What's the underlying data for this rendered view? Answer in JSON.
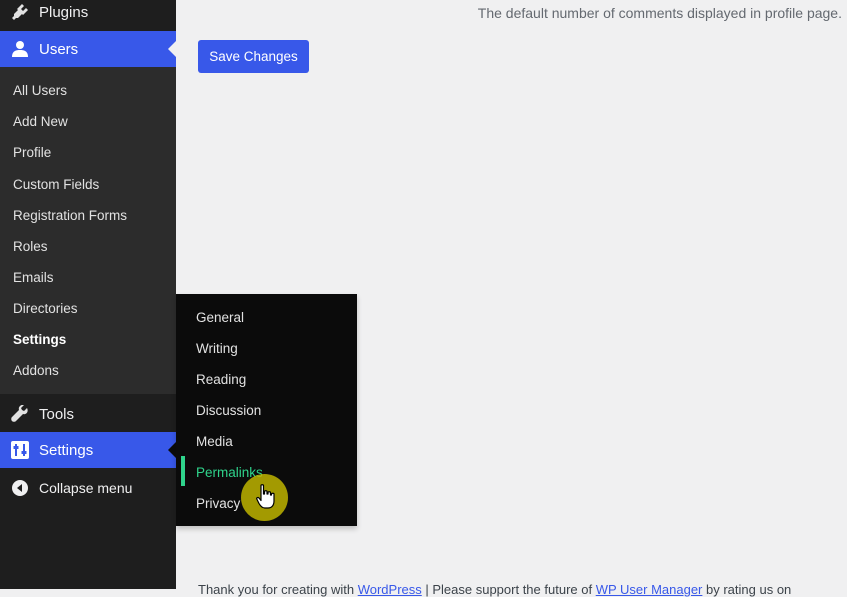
{
  "sidebar": {
    "plugins": {
      "label": "Plugins",
      "icon": "plugin-icon"
    },
    "users": {
      "label": "Users",
      "icon": "user-icon"
    },
    "users_submenu": [
      "All Users",
      "Add New",
      "Profile",
      "Custom Fields",
      "Registration Forms",
      "Roles",
      "Emails",
      "Directories",
      "Settings",
      "Addons"
    ],
    "users_current": "Settings",
    "tools": {
      "label": "Tools",
      "icon": "wrench-icon"
    },
    "settings": {
      "label": "Settings",
      "icon": "settings-sliders-icon"
    },
    "collapse": {
      "label": "Collapse menu",
      "icon": "collapse-arrow-icon"
    }
  },
  "settings_flyout": {
    "items": [
      "General",
      "Writing",
      "Reading",
      "Discussion",
      "Media",
      "Permalinks",
      "Privacy"
    ],
    "hovered": "Permalinks"
  },
  "main": {
    "description": "The default number of comments displayed in profile page.",
    "save_label": "Save Changes"
  },
  "footer": {
    "text_1": "Thank you for creating with ",
    "link_1": "WordPress",
    "text_2": " | Please support the future of ",
    "link_2": "WP User Manager",
    "text_3": " by rating us on "
  },
  "colors": {
    "accent": "#3858e9",
    "sidebar_bg": "#1e1e1e",
    "submenu_bg": "#2c2c2c",
    "flyout_bg": "#0b0b0b",
    "hover_green": "#2fd48c",
    "page_bg": "#f0f0f1",
    "cursor_highlight": "#bdb400"
  }
}
